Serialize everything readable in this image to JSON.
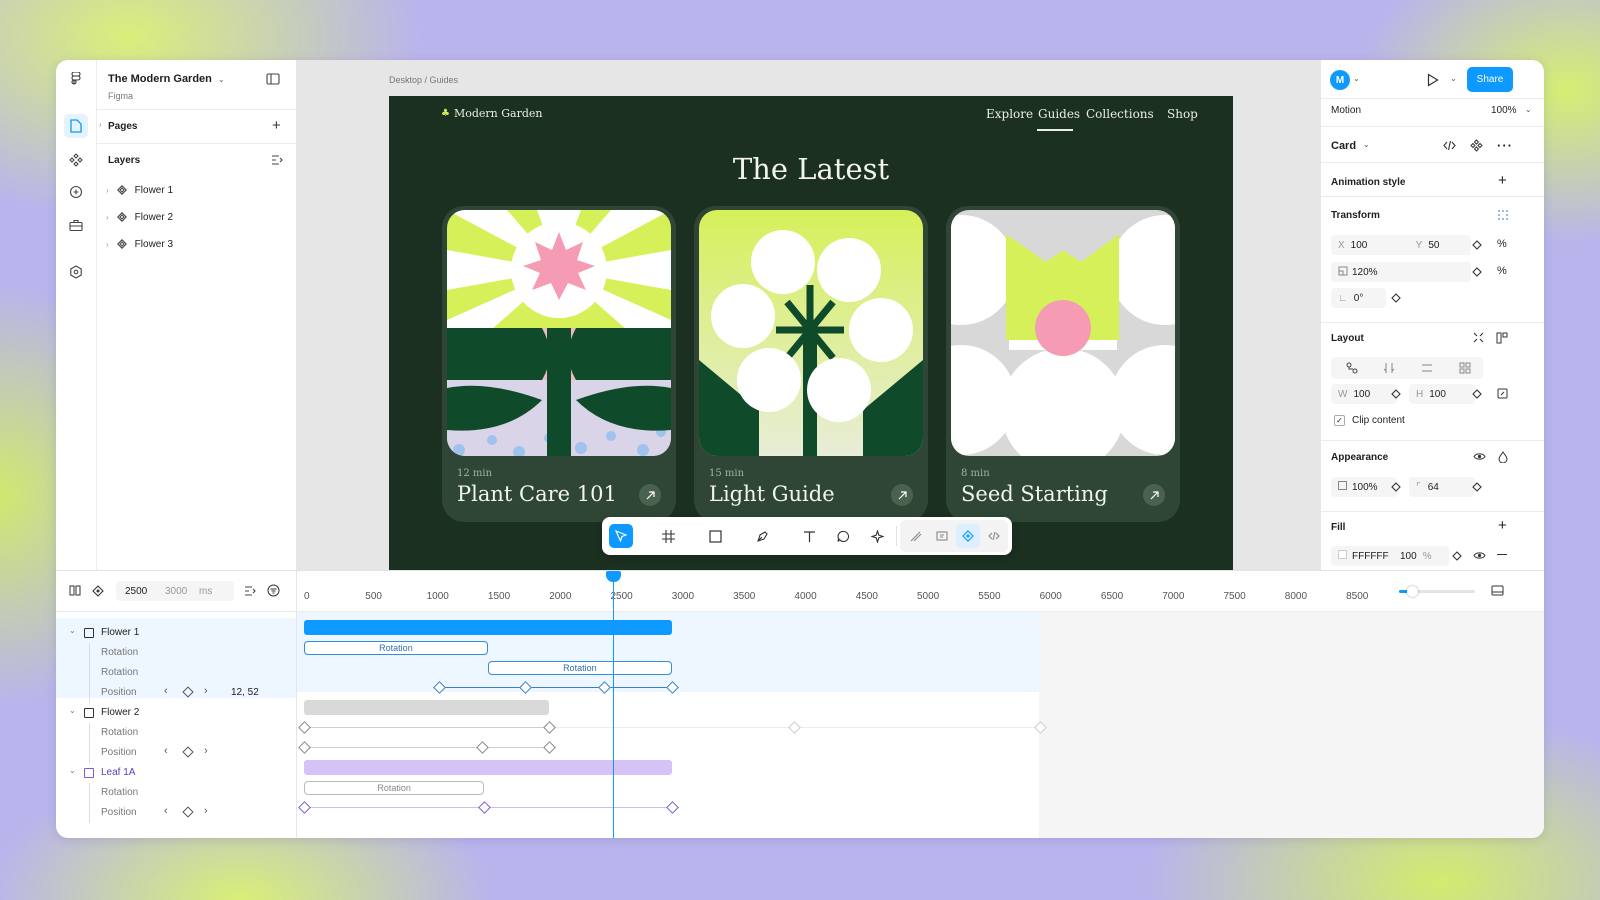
{
  "file": {
    "title": "The Modern Garden",
    "subtitle": "Figma"
  },
  "layers_panel": {
    "pages_label": "Pages",
    "layers_label": "Layers",
    "items": [
      "Flower 1",
      "Flower 2",
      "Flower 3"
    ]
  },
  "canvas": {
    "breadcrumb": "Desktop / Guides",
    "site": {
      "brand": "Modern Garden",
      "nav": [
        "Explore",
        "Guides",
        "Collections",
        "Shop"
      ],
      "active_nav": "Guides",
      "heading": "The Latest",
      "cards": [
        {
          "duration": "12 min",
          "title": "Plant Care 101"
        },
        {
          "duration": "15 min",
          "title": "Light Guide"
        },
        {
          "duration": "8 min",
          "title": "Seed Starting"
        }
      ]
    }
  },
  "properties": {
    "avatar_letter": "M",
    "share_label": "Share",
    "motion_label": "Motion",
    "zoom": "100%",
    "component_name": "Card",
    "animation_style_label": "Animation style",
    "transform": {
      "label": "Transform",
      "x_label": "X",
      "x": "100",
      "y_label": "Y",
      "y": "50",
      "scale": "120%",
      "rotation": "0°"
    },
    "layout": {
      "label": "Layout",
      "w_label": "W",
      "w": "100",
      "h_label": "H",
      "h": "100",
      "clip_label": "Clip content"
    },
    "appearance": {
      "label": "Appearance",
      "opacity": "100%",
      "radius": "64"
    },
    "fill": {
      "label": "Fill",
      "hex": "FFFFFF",
      "opacity": "100",
      "unit": "%"
    }
  },
  "timeline": {
    "current_time": "2500",
    "duration": "3000",
    "unit": "ms",
    "ticks": [
      "0",
      "500",
      "1000",
      "1500",
      "2000",
      "2500",
      "3000",
      "3500",
      "4000",
      "4500",
      "5000",
      "5500",
      "6000",
      "6500",
      "7000",
      "7500",
      "8000",
      "8500"
    ],
    "tracks": [
      {
        "name": "Flower 1",
        "kind": "group"
      },
      {
        "name": "Rotation",
        "kind": "prop"
      },
      {
        "name": "Rotation",
        "kind": "prop"
      },
      {
        "name": "Position",
        "kind": "prop",
        "value": "12, 52"
      },
      {
        "name": "Flower 2",
        "kind": "group"
      },
      {
        "name": "Rotation",
        "kind": "prop"
      },
      {
        "name": "Position",
        "kind": "prop"
      },
      {
        "name": "Leaf 1A",
        "kind": "group"
      },
      {
        "name": "Rotation",
        "kind": "prop"
      },
      {
        "name": "Position",
        "kind": "prop"
      }
    ],
    "clip_labels": [
      "Rotation",
      "Rotation",
      "Rotation"
    ]
  },
  "colors": {
    "accent": "#0d99ff",
    "frame_bg": "#1b3020",
    "card_bg": "#2f4636",
    "lime": "#d6f05a",
    "pink": "#f59bb4",
    "forest": "#0f4a2b",
    "leaf_purple": "#d7c2f7"
  }
}
